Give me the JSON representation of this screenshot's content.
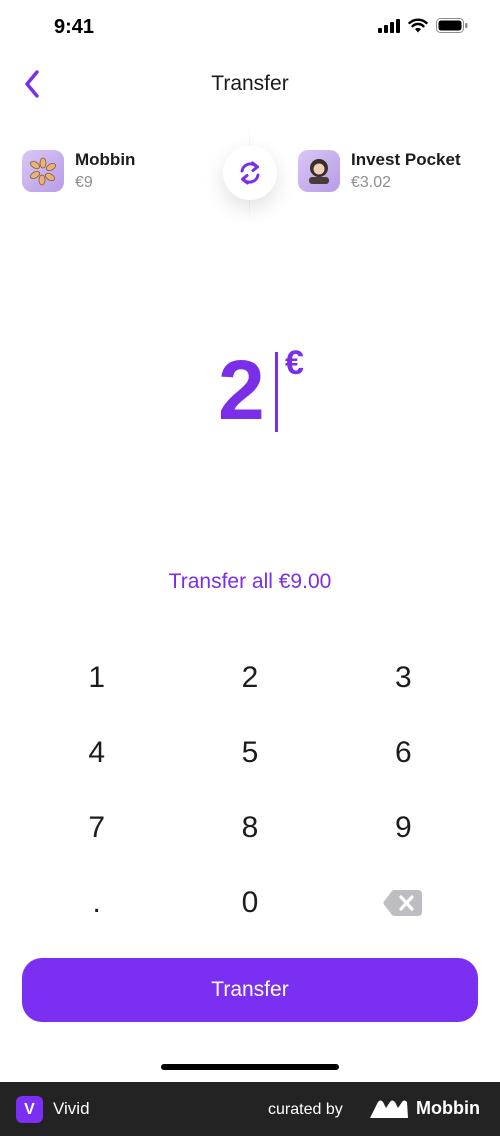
{
  "status_bar": {
    "time": "9:41",
    "icons": [
      "signal-icon",
      "wifi-icon",
      "battery-icon"
    ]
  },
  "nav": {
    "title": "Transfer",
    "back_icon": "chevron-left-icon"
  },
  "accounts": {
    "from": {
      "name": "Mobbin",
      "balance": "€9"
    },
    "to": {
      "name": "Invest Pocket",
      "balance": "€3.02"
    },
    "swap_icon": "swap-arrows-icon"
  },
  "amount": {
    "value": "2",
    "currency": "€"
  },
  "transfer_all_label": "Transfer all €9.00",
  "keypad": {
    "keys": [
      "1",
      "2",
      "3",
      "4",
      "5",
      "6",
      "7",
      "8",
      "9",
      ".",
      "0"
    ],
    "delete_icon": "backspace-icon"
  },
  "cta_label": "Transfer",
  "footer": {
    "brand": "Vivid",
    "brand_initial": "V",
    "curated_by": "curated by",
    "curator": "Mobbin"
  },
  "colors": {
    "accent": "#7b2ff2",
    "text": "#1c1c1e",
    "muted": "#8e8e93",
    "footer_bg": "#232323"
  }
}
